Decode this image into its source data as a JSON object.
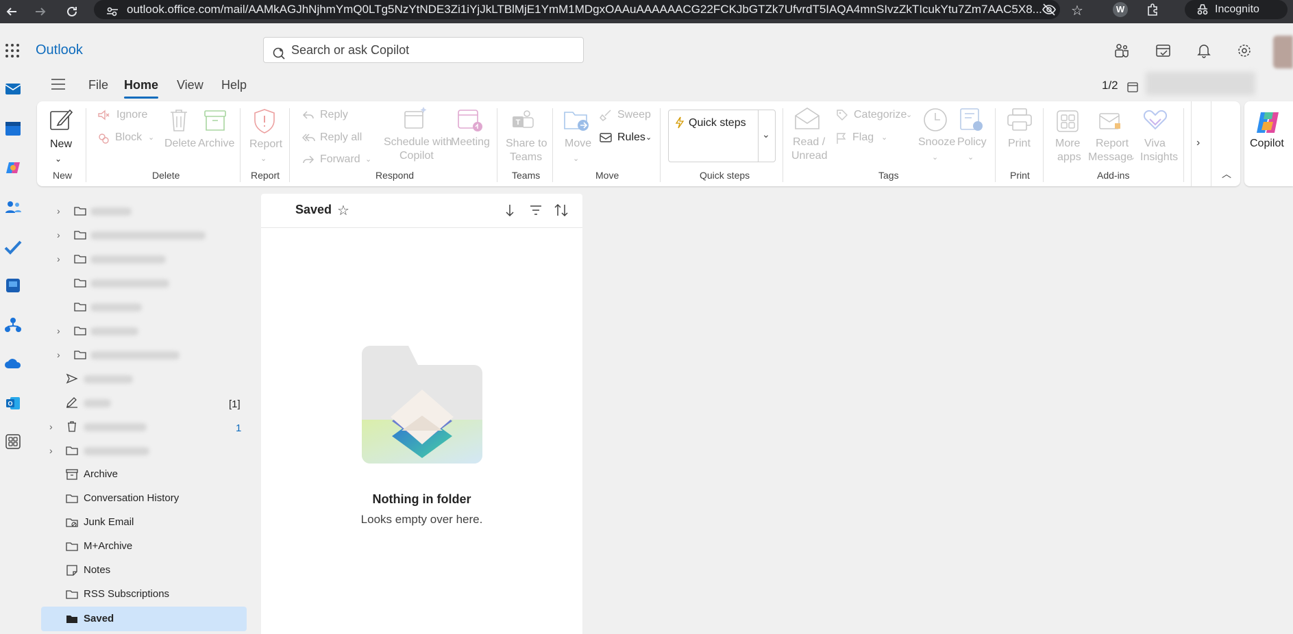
{
  "browser": {
    "url": "outlook.office.com/mail/AAMkAGJhNjhmYmQ0LTg5NzYtNDE3Zi1iYjJkLTBlMjE1YmM1MDgxOAAuAAAAAACG22FCKJbGTZk7UfvrdT5IAQA4mnSIvzZkTIcukYtu7Zm7AAC5X8...",
    "incognito_label": "Incognito"
  },
  "app": {
    "name": "Outlook"
  },
  "search": {
    "placeholder": "Search or ask Copilot"
  },
  "menu": {
    "tabs": [
      {
        "label": "File"
      },
      {
        "label": "Home",
        "active": true
      },
      {
        "label": "View"
      },
      {
        "label": "Help"
      }
    ],
    "page_indicator": "1/2"
  },
  "ribbon": {
    "new": {
      "label": "New",
      "group": "New"
    },
    "delete_group": {
      "ignore": "Ignore",
      "block": "Block",
      "delete": "Delete",
      "archive": "Archive",
      "group": "Delete"
    },
    "report_group": {
      "report": "Report",
      "group": "Report"
    },
    "respond_group": {
      "reply": "Reply",
      "reply_all": "Reply all",
      "forward": "Forward",
      "schedule_line1": "Schedule with",
      "schedule_line2": "Copilot",
      "meeting": "Meeting",
      "group": "Respond"
    },
    "teams_group": {
      "share_line1": "Share to",
      "share_line2": "Teams",
      "group": "Teams"
    },
    "move_group": {
      "move": "Move",
      "sweep": "Sweep",
      "rules": "Rules",
      "group": "Move"
    },
    "quick_steps_group": {
      "quick_steps": "Quick steps",
      "group": "Quick steps"
    },
    "tags_group": {
      "read_line1": "Read /",
      "read_line2": "Unread",
      "categorize": "Categorize",
      "flag": "Flag",
      "snooze": "Snooze",
      "policy": "Policy",
      "group": "Tags"
    },
    "print_group": {
      "print": "Print",
      "group": "Print"
    },
    "addins_group": {
      "more_line1": "More",
      "more_line2": "apps",
      "report_line1": "Report",
      "report_line2": "Message",
      "viva_line1": "Viva",
      "viva_line2": "Insights",
      "group": "Add-ins"
    },
    "copilot": "Copilot"
  },
  "folders": {
    "items": [
      {
        "label": "Archive"
      },
      {
        "label": "Conversation History"
      },
      {
        "label": "Junk Email"
      },
      {
        "label": "M+Archive"
      },
      {
        "label": "Notes"
      },
      {
        "label": "RSS Subscriptions"
      },
      {
        "label": "Saved",
        "selected": true
      }
    ],
    "drafts_count": "[1]",
    "deleted_count": "1"
  },
  "message_list": {
    "title": "Saved",
    "empty_title": "Nothing in folder",
    "empty_subtitle": "Looks empty over here."
  },
  "colors": {
    "accent": "#0f6cbd",
    "selected_bg": "#cfe4fa",
    "disabled_text": "#b8b8b8"
  }
}
